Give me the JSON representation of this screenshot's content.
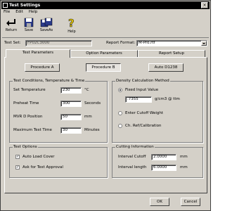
{
  "window": {
    "title": "Test Settings"
  },
  "menu": [
    "File",
    "Edit",
    "Help"
  ],
  "toolbar": [
    {
      "label": "Return",
      "icon": "return-arrow-icon"
    },
    {
      "label": "Save",
      "icon": "floppy-disk-icon"
    },
    {
      "label": "SaveAs",
      "icon": "floppy-disk-save-as-icon"
    },
    {
      "label": "Help",
      "icon": "help-question-icon"
    }
  ],
  "file": {
    "test_set_label": "Test Set:",
    "test_set_value": "FP02C3000",
    "report_format_label": "Report Format:",
    "report_format_value": "M-Pro.rtf"
  },
  "tabs": [
    "Test Parameters",
    "Option Parameters",
    "Report Setup"
  ],
  "procedures": [
    "Procedure A",
    "Procedure B",
    "Auto D1238"
  ],
  "test_conditions": {
    "title": "Test Conditions, Temperature & Time",
    "rows": [
      {
        "label": "Set Temperature",
        "value": "230",
        "unit": "°C"
      },
      {
        "label": "Preheat Time",
        "value": "300",
        "unit": "Seconds"
      },
      {
        "label": "MVR D Position",
        "value": "50",
        "unit": "mm"
      },
      {
        "label": "Maximum Test Time",
        "value": "30",
        "unit": "Minutes"
      }
    ]
  },
  "density": {
    "title": "Density Calculation Method",
    "option1": "Fixed Input Value",
    "value": ".7355",
    "unit": "g/cm3 @ ttm",
    "option2": "Enter Cutoff Weight",
    "option3": "Ch. Ref/Calibration"
  },
  "test_options": {
    "title": "Test Options",
    "opt1": "Auto Load Cover",
    "opt2": "Ask for Test Approval"
  },
  "cutting": {
    "title": "Cutting Information",
    "rows": [
      {
        "label": "Interval Cutoff",
        "value": "2.0000",
        "unit": "mm"
      },
      {
        "label": "Interval length",
        "value": "6.0000",
        "unit": "mm"
      }
    ]
  },
  "buttons": {
    "ok": "OK",
    "cancel": "Cancel"
  }
}
